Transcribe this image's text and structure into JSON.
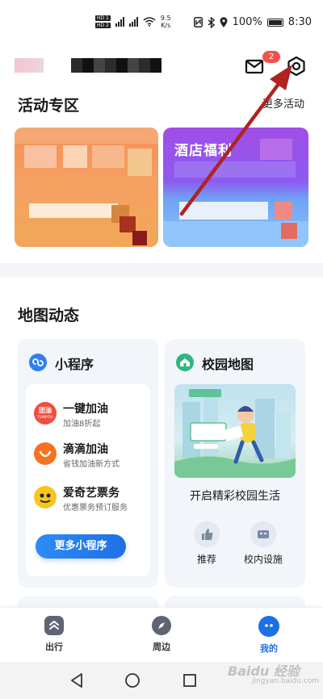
{
  "status_bar": {
    "speed_value": "9.5",
    "speed_unit": "K/s",
    "battery_percent": "100%",
    "time": "8:30",
    "icons": [
      "hd-icon",
      "signal-5g-icon",
      "signal-4g-icon",
      "wifi-icon",
      "nfc-icon",
      "bluetooth-icon",
      "location-icon",
      "battery-icon"
    ]
  },
  "header": {
    "mail_badge": "2",
    "mail_icon": "mail-icon",
    "settings_icon": "gear-icon"
  },
  "activity": {
    "title": "活动专区",
    "more_label": "更多活动",
    "banner_right_title": "酒店福利"
  },
  "map_dynamic": {
    "title": "地图动态",
    "mini_programs": {
      "title": "小程序",
      "items": [
        {
          "name": "一键加油",
          "desc": "加油8折起",
          "logo_text": "团油",
          "logo_subtext": "TUANYOU"
        },
        {
          "name": "滴滴加油",
          "desc": "省钱加油新方式"
        },
        {
          "name": "爱奇艺票务",
          "desc": "优惠票务预订服务"
        }
      ],
      "more_button": "更多小程序"
    },
    "campus_map": {
      "title": "校园地图",
      "caption": "开启精彩校园生活",
      "shortcuts": [
        {
          "label": "推荐",
          "icon": "thumbs-up-icon"
        },
        {
          "label": "校内设施",
          "icon": "facilities-icon"
        }
      ]
    }
  },
  "tabbar": {
    "tabs": [
      {
        "label": "出行",
        "icon": "travel-icon"
      },
      {
        "label": "周边",
        "icon": "compass-icon"
      },
      {
        "label": "我的",
        "icon": "profile-face-icon"
      }
    ],
    "active_index": 2
  },
  "watermark": {
    "text": "Baidu 经验",
    "sub": "jingyan.baidu.com"
  },
  "colors": {
    "accent_blue": "#1f6fe5",
    "badge_red": "#f0534c",
    "arrow_red": "#b0231f"
  }
}
